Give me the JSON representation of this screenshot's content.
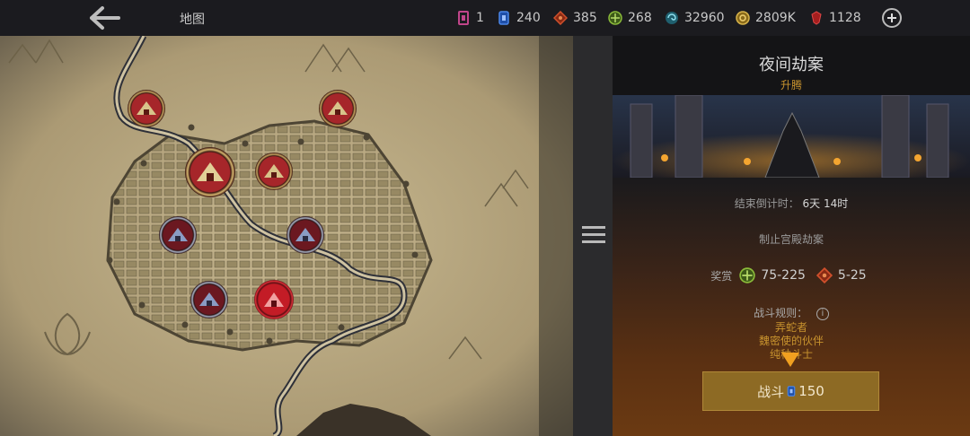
{
  "topbar": {
    "title": "地图",
    "back_icon": "arrow-left-icon",
    "resources": [
      {
        "name": "ticket",
        "icon": "ticket-icon",
        "value": "1",
        "color": "#c0458a"
      },
      {
        "name": "energy",
        "icon": "energy-card-icon",
        "value": "240",
        "color": "#2f6fd6"
      },
      {
        "name": "red-shard",
        "icon": "red-diamond-icon",
        "value": "385",
        "color": "#d0502c"
      },
      {
        "name": "green-emblem",
        "icon": "green-emblem-icon",
        "value": "268",
        "color": "#6f9a2e"
      },
      {
        "name": "essence",
        "icon": "swirl-icon",
        "value": "32960",
        "color": "#3aa0b8"
      },
      {
        "name": "gold",
        "icon": "gold-coin-icon",
        "value": "2809K",
        "color": "#c9a23a"
      },
      {
        "name": "ruby",
        "icon": "ruby-icon",
        "value": "1128",
        "color": "#b82828"
      }
    ],
    "add_icon": "plus-circle-icon"
  },
  "map": {
    "markers": [
      {
        "name": "marker-tent-top-left",
        "state": "red"
      },
      {
        "name": "marker-tent-top-right",
        "state": "red"
      },
      {
        "name": "marker-tent-selected",
        "state": "selected"
      },
      {
        "name": "marker-tent-center",
        "state": "red"
      },
      {
        "name": "marker-tent-blue-left",
        "state": "blue"
      },
      {
        "name": "marker-tent-blue-right",
        "state": "blue"
      },
      {
        "name": "marker-tent-blue-bottom",
        "state": "blue"
      },
      {
        "name": "marker-tent-bottom-red",
        "state": "active"
      }
    ]
  },
  "panel": {
    "title": "夜间劫案",
    "subtitle": "升腾",
    "timer_label": "结束倒计时：",
    "timer_value": "6天 14时",
    "objective": "制止宫殿劫案",
    "reward_label": "奖赏",
    "rewards": [
      {
        "icon": "green-emblem-icon",
        "value": "75-225"
      },
      {
        "icon": "red-diamond-icon",
        "value": "5-25"
      }
    ],
    "rules_label": "战斗规则：",
    "rules": [
      "弄蛇者",
      "魏密使的伙伴",
      "纯种斗士"
    ],
    "fight_label": "战斗",
    "fight_cost": "150",
    "colors": {
      "accent": "#c8932e",
      "button": "#8d6a24",
      "arrow": "#f0a020"
    }
  }
}
